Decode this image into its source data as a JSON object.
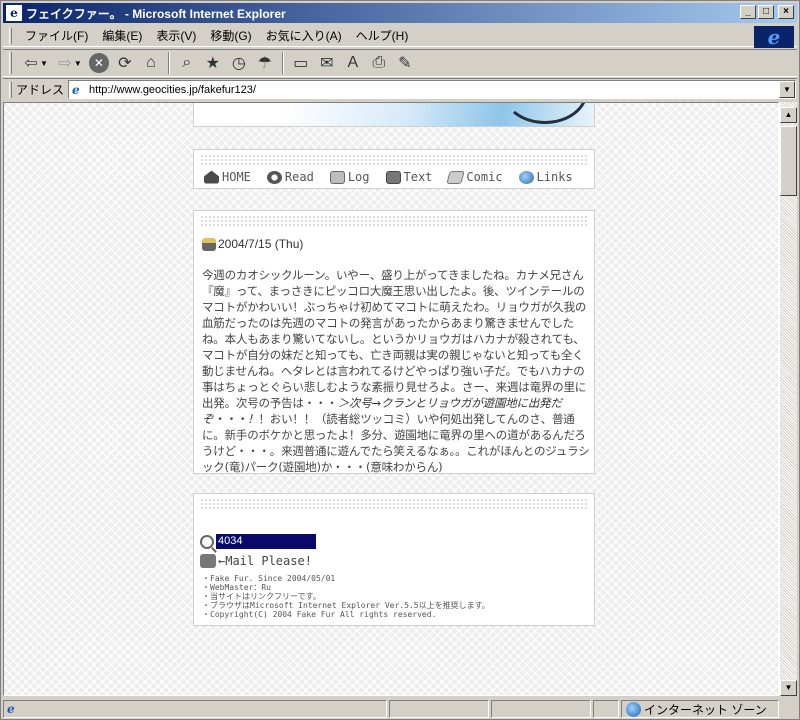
{
  "window": {
    "title": "フェイクファー。 - Microsoft Internet Explorer",
    "min_glyph": "_",
    "max_glyph": "□",
    "close_glyph": "×"
  },
  "menubar": {
    "items": [
      "ファイル(F)",
      "編集(E)",
      "表示(V)",
      "移動(G)",
      "お気に入り(A)",
      "ヘルプ(H)"
    ]
  },
  "toolbar": {
    "buttons": [
      "back",
      "forward",
      "stop",
      "refresh",
      "home",
      "search",
      "favorites",
      "history",
      "channels",
      "fullscreen",
      "mail",
      "font",
      "print",
      "edit"
    ]
  },
  "address": {
    "label": "アドレス",
    "url": "http://www.geocities.jp/fakefur123/"
  },
  "nav": {
    "items": [
      "HOME",
      "Read",
      "Log",
      "Text",
      "Comic",
      "Links"
    ]
  },
  "post": {
    "date": "2004/7/15 (Thu)",
    "body_1": "今週のカオシックルーン。いやー、盛り上がってきましたね。カナメ兄さん『魔』って、まっさきにピッコロ大魔王思い出したよ。後、ツインテールのマコトがかわいい！ぶっちゃけ初めてマコトに萌えたわ。リョウガが久我の血筋だったのは先週のマコトの発言があったからあまり驚きませんでしたね。本人もあまり驚いてないし。というかリョウガはハカナが殺されても、マコトが自分の妹だと知っても、亡き両親は実の親じゃないと知っても全く動じませんね。ヘタレとは言われてるけどやっぱり強い子だ。でもハカナの事はちょっとぐらい悲しむような素振り見せろよ。さー、来週は竜界の里に出発。次号の予告は・・・",
    "body_em": "＞次号→クランとリョウガが遊園地に出発だぞ・・・！",
    "body_2": "！おい！！（読者総ツッコミ）いや何処出発してんのさ、普通に。新手のボケかと思ったよ！多分、遊園地に竜界の里への道があるんだろうけど・・・。来週普通に遊んでたら笑えるなぁ。。これがほんとのジュラシック(竜)パーク(遊園地)か・・・(意味わからん)"
  },
  "footer": {
    "counter": "4034",
    "mail": "←Mail Please!",
    "notes": [
      "・Fake Fur. Since 2004/05/01",
      "・WebMaster：Ru",
      "・当サイトはリンクフリーです。",
      "・ブラウザはMicrosoft Internet Explorer Ver.5.5以上を推奨します。",
      "・Copyright(C) 2004 Fake Fur All rights reserved."
    ]
  },
  "status": {
    "text": "",
    "zone": "インターネット ゾーン"
  },
  "colors": {
    "title_start": "#0a246a",
    "title_end": "#a6caf0",
    "counter_bg": "#0a0a6a"
  }
}
